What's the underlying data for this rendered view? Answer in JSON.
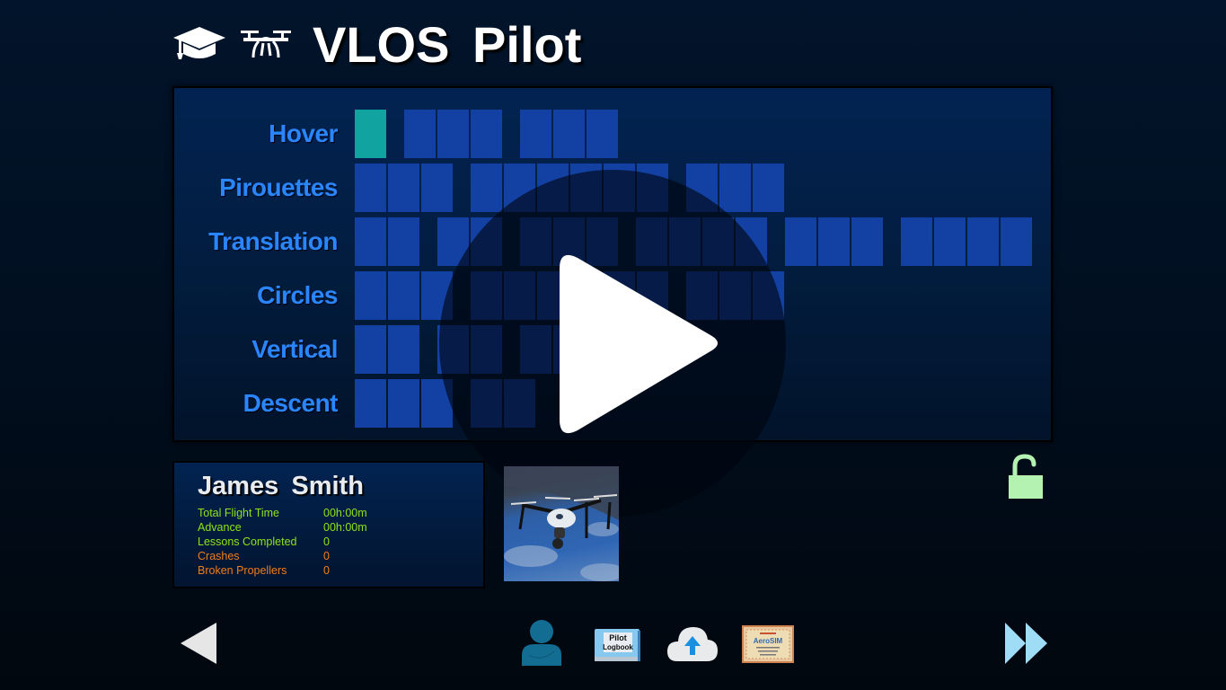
{
  "header": {
    "title": "VLOS Pilot",
    "icons": [
      "graduation-cap-icon",
      "drone-icon"
    ]
  },
  "lessons": {
    "rows": [
      {
        "label": "Hover",
        "groups": [
          1,
          3,
          3
        ],
        "completed": 1
      },
      {
        "label": "Pirouettes",
        "groups": [
          3,
          6,
          3
        ],
        "completed": 0
      },
      {
        "label": "Translation",
        "groups": [
          2,
          2,
          3,
          4,
          3,
          4
        ],
        "completed": 0
      },
      {
        "label": "Circles",
        "groups": [
          3,
          6,
          3
        ],
        "completed": 0
      },
      {
        "label": "Vertical",
        "groups": [
          2,
          2,
          2
        ],
        "completed": 0
      },
      {
        "label": "Descent",
        "groups": [
          3,
          2
        ],
        "completed": 0
      }
    ],
    "colors": {
      "pending": "#1241a3",
      "completed": "#11a3a0",
      "label": "#2a86ff"
    }
  },
  "play_button": {
    "icon": "play-icon"
  },
  "pilot": {
    "name": "James  Smith",
    "stats": [
      {
        "label": "Total Flight Time",
        "value": "00h:00m",
        "tone": "green"
      },
      {
        "label": "Advance",
        "value": "00h:00m",
        "tone": "green"
      },
      {
        "label": "Lessons Completed",
        "value": "0",
        "tone": "green"
      },
      {
        "label": "Crashes",
        "value": "0",
        "tone": "orange"
      },
      {
        "label": "Broken Propellers",
        "value": "0",
        "tone": "orange"
      }
    ]
  },
  "drone_image": {
    "alt": "Quadcopter drone in sky"
  },
  "lock": {
    "state": "unlocked",
    "color": "#b3f2b0"
  },
  "bottom_nav": {
    "back": "back-arrow-icon",
    "profile": "user-profile-icon",
    "logbook": {
      "line1": "Pilot",
      "line2": "Logbook"
    },
    "upload": "cloud-upload-icon",
    "certificate": {
      "brand": "AeroSIM"
    },
    "forward": "fast-forward-icon"
  }
}
